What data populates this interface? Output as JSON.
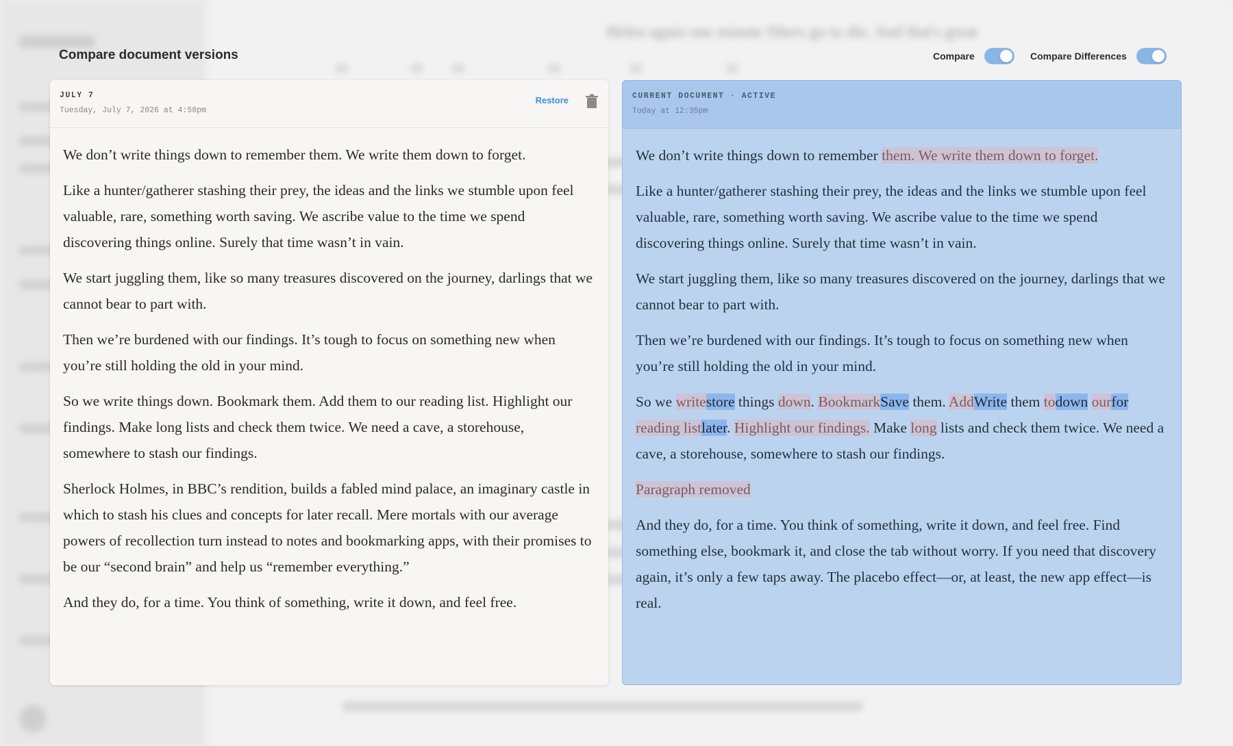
{
  "background": {
    "doc_title": "Helen again one minute filters go to die. And that's great"
  },
  "overlay": {
    "title": "Compare document versions",
    "toggles": [
      {
        "label": "Compare",
        "on": true
      },
      {
        "label": "Compare Differences",
        "on": true
      }
    ]
  },
  "left_panel": {
    "label": "JULY 7",
    "date": "Tuesday, July 7, 2026 at 4:58pm",
    "restore_label": "Restore",
    "paragraphs": [
      "We don’t write things down to remember them. We write them down to forget.",
      "Like a hunter/gatherer stashing their prey, the ideas and the links we stumble upon feel valuable, rare, something worth saving. We ascribe value to the time we spend discovering things online. Surely that time wasn’t in vain.",
      "We start juggling them, like so many treasures discovered on the journey, darlings that we cannot bear to part with.",
      "Then we’re burdened with our findings. It’s tough to focus on something new when you’re still holding the old in your mind.",
      "So we write things down. Bookmark them. Add them to our reading list. Highlight our findings. Make long lists and check them twice. We need a cave, a storehouse, somewhere to stash our findings.",
      "Sherlock Holmes, in BBC’s rendition, builds a fabled mind palace, an imaginary castle in which to stash his clues and concepts for later recall. Mere mortals with our average powers of recollection turn instead to notes and bookmarking apps, with their promises to be our “second brain” and help us “remember everything.”",
      "And they do, for a time. You think of something, write it down, and feel free."
    ]
  },
  "right_panel": {
    "label": "CURRENT DOCUMENT · ACTIVE",
    "date": "Today at 12:35pm",
    "p1": {
      "a": "We don’t write things down to remember ",
      "del": "them. We write them down to forget."
    },
    "p2": "Like a hunter/gatherer stashing their prey, the ideas and the links we stumble upon feel valuable, rare, something worth saving. We ascribe value to the time we spend discovering things online. Surely that time wasn’t in vain.",
    "p3": "We start juggling them, like so many treasures discovered on the journey, darlings that we cannot bear to part with.",
    "p4": "Then we’re burdened with our findings. It’s tough to focus on something new when you’re still holding the old in your mind.",
    "p5": {
      "t1": "So we ",
      "d1": "write",
      "i1": "store",
      "t2": " things ",
      "d2": "down",
      "t3": ". ",
      "d3": "Bookmark",
      "i3": "Save",
      "t4": " them. ",
      "d4": "Add",
      "i4": "Write",
      "t5": " them ",
      "d5": "to",
      "i5": "down",
      "t6": " ",
      "d6": "our",
      "i6": "for",
      "t7": " ",
      "d7": "reading list",
      "i7": "later",
      "t8": ". ",
      "d8": "Highlight our findings.",
      "t9": " Make ",
      "d9": "long",
      "t10": " lists and check them twice. We need a cave, a storehouse, somewhere to stash our findings."
    },
    "removed_label": "Paragraph removed",
    "p7": "And they do, for a time. You think of something, write it down, and feel free. Find something else, bookmark it, and close the tab without worry. If you need that discovery again, it’s only a few taps away. The placebo effect—or, at least, the new app effect—is real."
  }
}
